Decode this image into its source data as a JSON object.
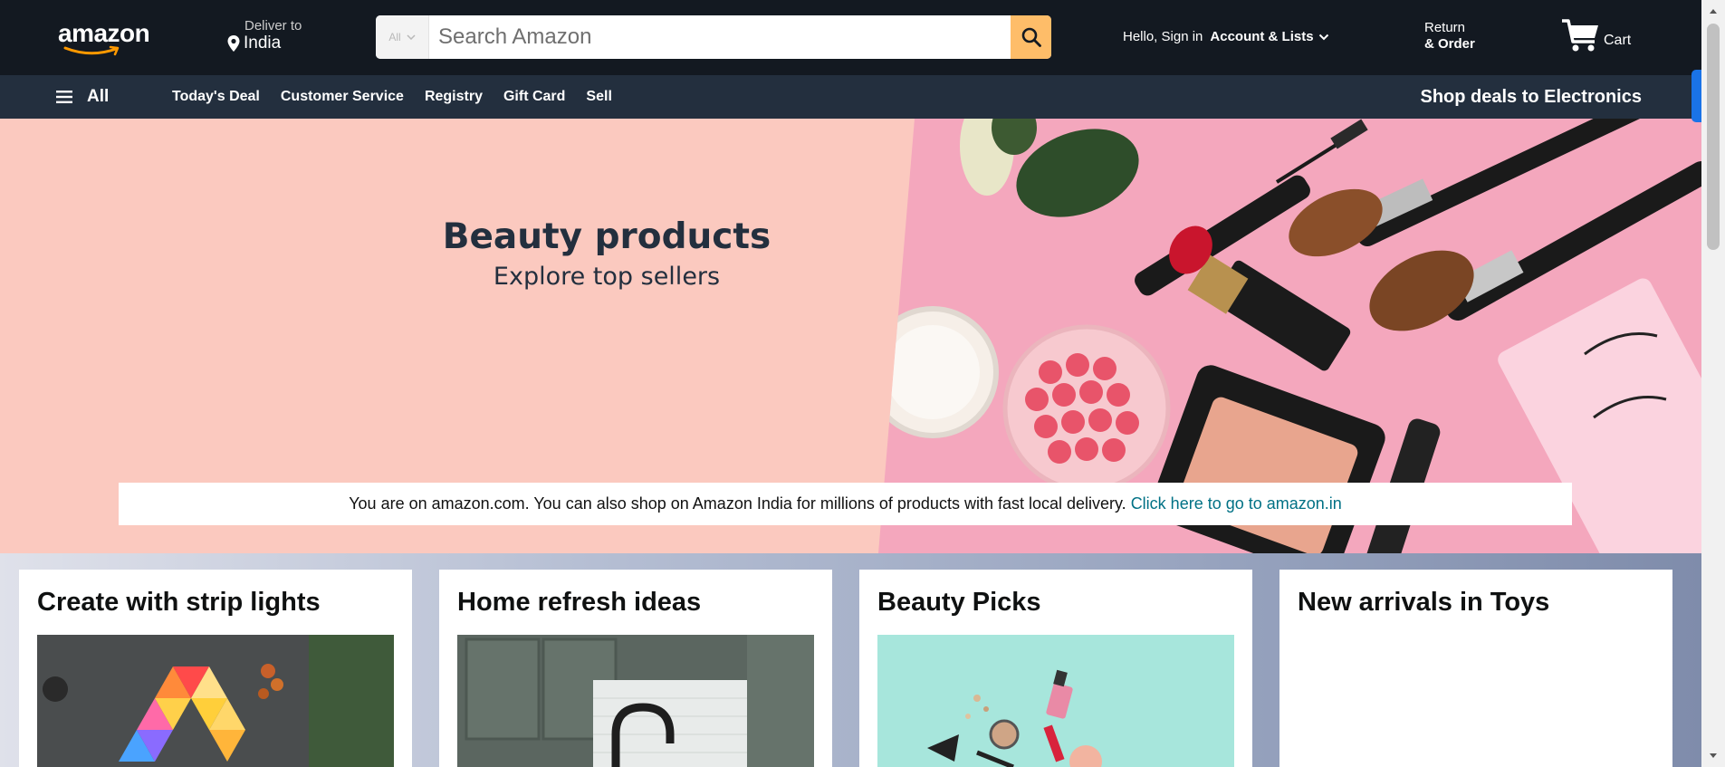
{
  "header": {
    "logo_text": "amazon",
    "deliver_label": "Deliver to",
    "deliver_location": "India",
    "search": {
      "category": "All",
      "placeholder": "Search Amazon"
    },
    "account": {
      "greeting": "Hello, Sign in",
      "lists": "Account & Lists"
    },
    "returns": {
      "line1": "Return",
      "line2": "& Order"
    },
    "cart_label": "Cart"
  },
  "nav": {
    "all_label": "All",
    "links": [
      "Today's Deal",
      "Customer Service",
      "Registry",
      "Gift Card",
      "Sell"
    ],
    "promo": "Shop deals to Electronics"
  },
  "hero": {
    "title": "Beauty products",
    "subtitle": "Explore top sellers",
    "notice_text": "You are on amazon.com. You can also shop on Amazon India for millions of products with fast local delivery.",
    "notice_link": "Click here to go to amazon.in"
  },
  "cards": [
    {
      "title": "Create with strip lights"
    },
    {
      "title": "Home refresh ideas"
    },
    {
      "title": "Beauty Picks"
    },
    {
      "title": "New arrivals in Toys"
    }
  ],
  "colors": {
    "header_bg": "#131921",
    "nav_bg": "#232f3e",
    "search_button": "#febd69",
    "hero_bg": "#fbc9bf",
    "link": "#007185"
  }
}
